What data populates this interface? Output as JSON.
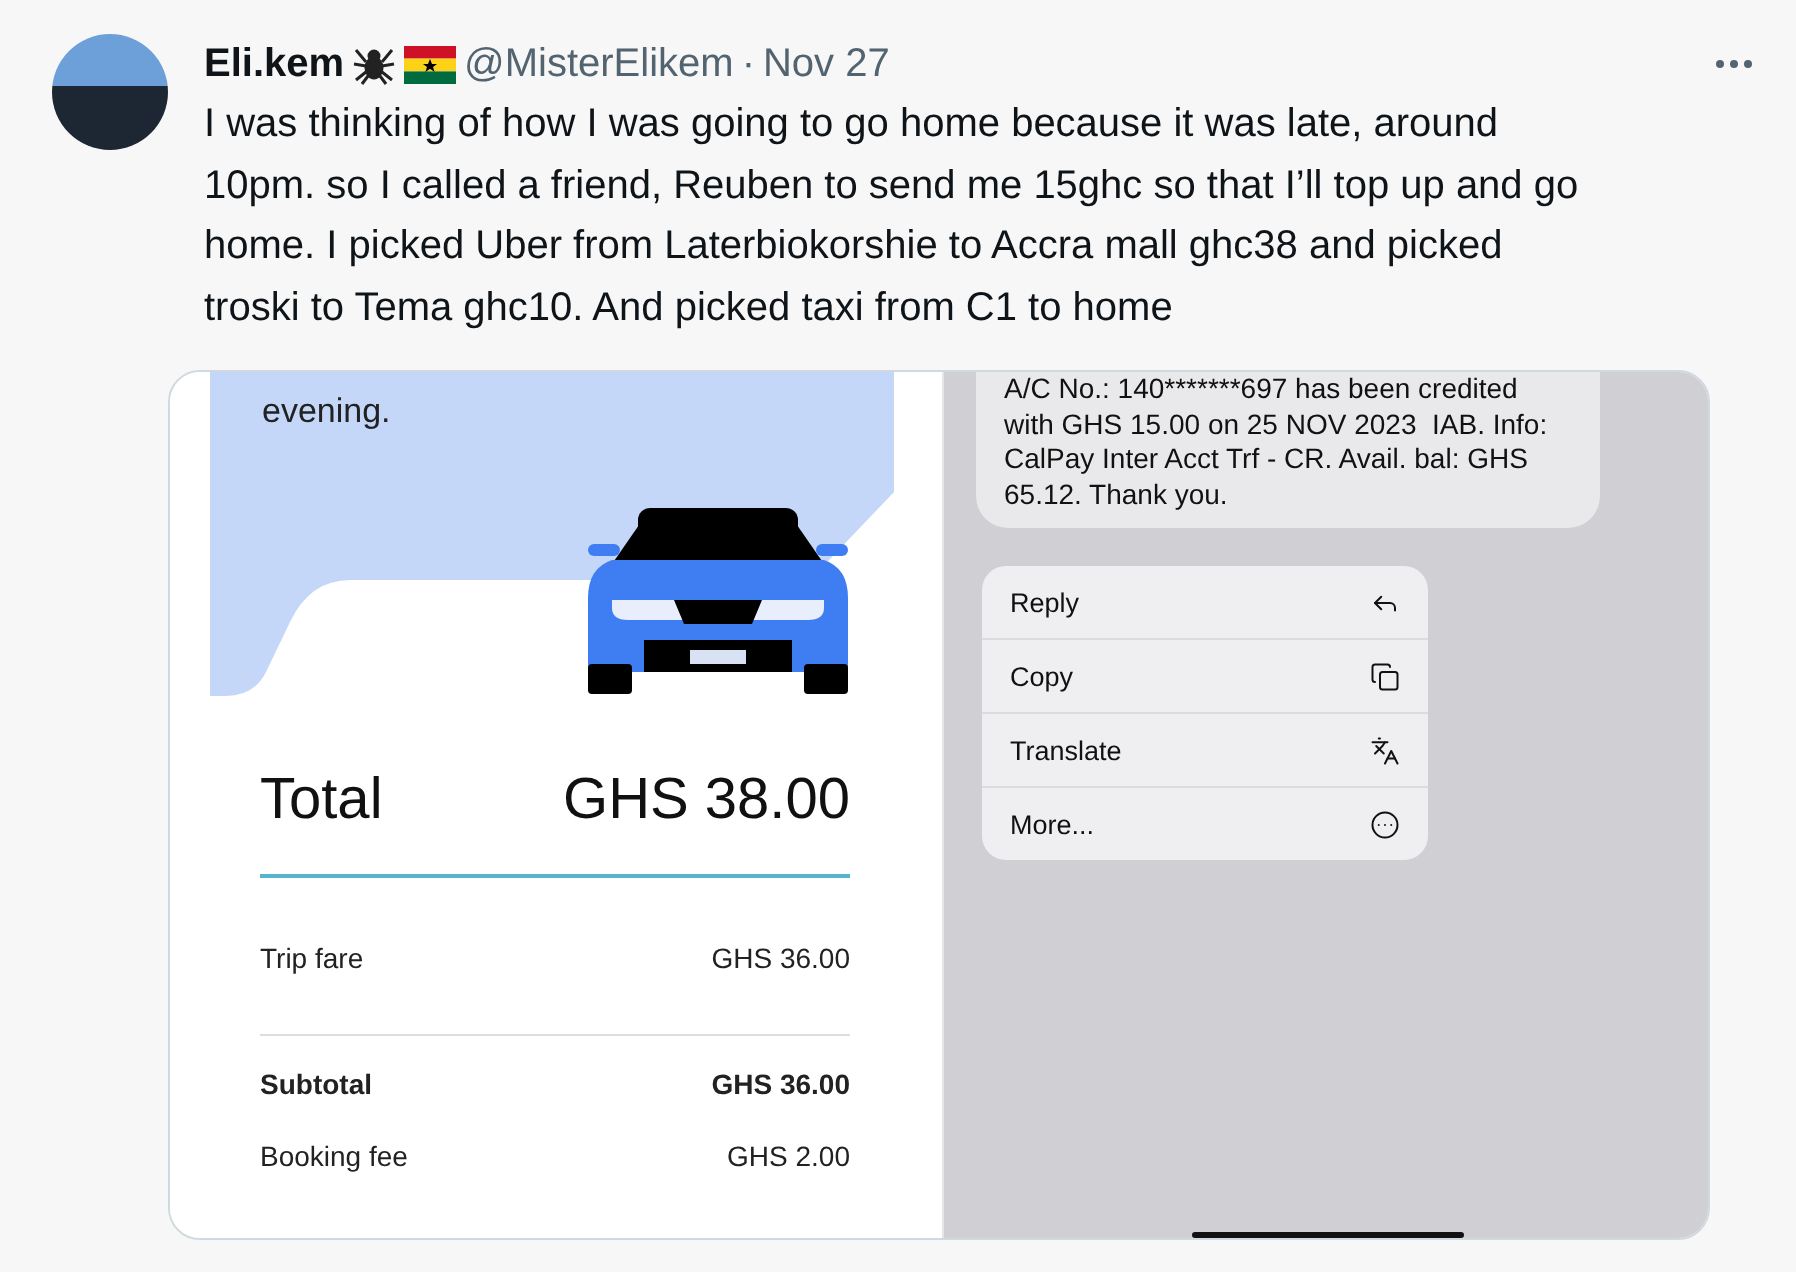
{
  "tweet": {
    "name": "Eli.kem",
    "handle": "@MisterElikem",
    "separator": "·",
    "date": "Nov 27",
    "text": "I was thinking of how I was going to go home because it was late, around 10pm. so I called a friend, Reuben to send me 15ghc so that I’ll top up and go home. I picked Uber from Laterbiokorshie to Accra mall ghc38 and picked troski to Tema ghc10. And picked taxi from C1 to home"
  },
  "receipt": {
    "greeting": "evening.",
    "total_label": "Total",
    "total_value": "GHS 38.00",
    "lines": [
      {
        "label": "Trip fare",
        "value": "GHS 36.00",
        "bold": false
      },
      {
        "label": "Subtotal",
        "value": "GHS 36.00",
        "bold": true
      },
      {
        "label": "Booking fee",
        "value": "GHS 2.00",
        "bold": false
      }
    ]
  },
  "message": {
    "text": "A/C No.: 140*******697 has been credited with GHS 15.00 on 25 NOV 2023  IAB. Info: CalPay Inter Acct Trf - CR. Avail. bal: GHS 65.12. Thank you.",
    "menu": [
      "Reply",
      "Copy",
      "Translate",
      "More..."
    ]
  }
}
